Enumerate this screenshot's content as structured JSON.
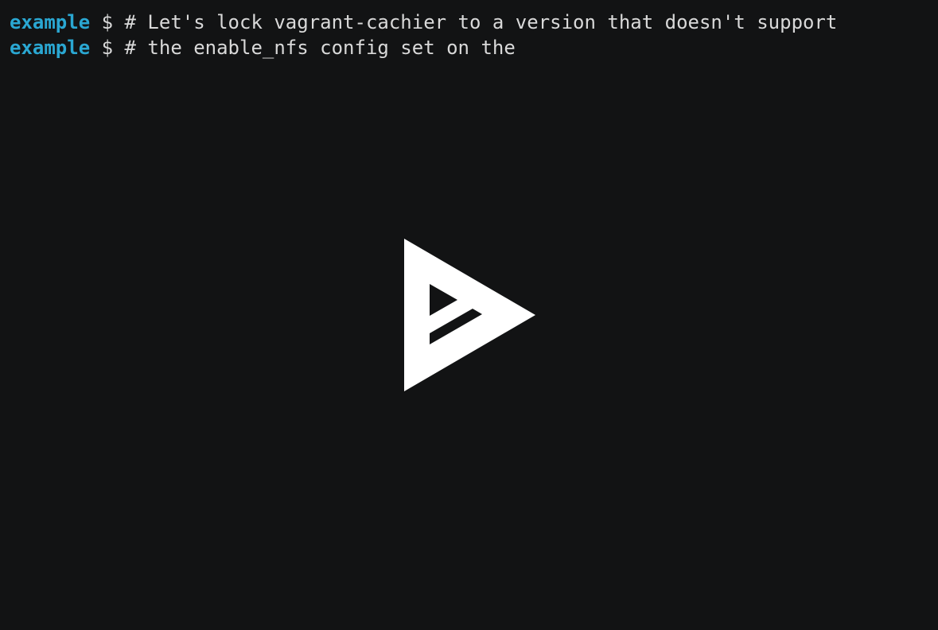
{
  "colors": {
    "background": "#121314",
    "prompt": "#2aa7d2",
    "text": "#d9d9d9",
    "logo": "#ffffff"
  },
  "terminal": {
    "lines": [
      {
        "prompt": "example",
        "dollar": "$",
        "command": "# Let's lock vagrant-cachier to a version that doesn't support"
      },
      {
        "prompt": "example",
        "dollar": "$",
        "command": "# the enable_nfs config set on the"
      }
    ]
  },
  "player": {
    "icon": "asciinema-play-icon"
  }
}
